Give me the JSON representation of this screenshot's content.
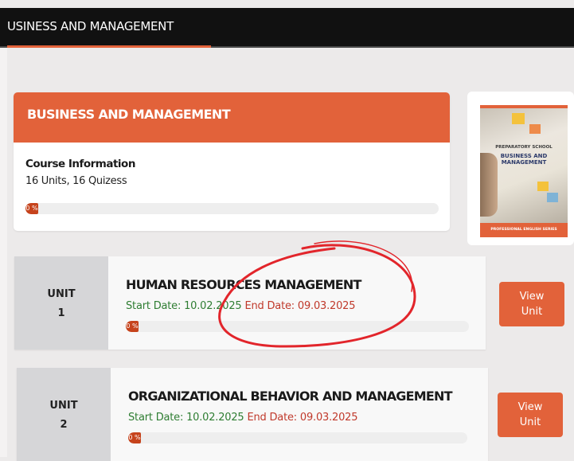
{
  "header": {
    "tab_label": "USINESS AND MANAGEMENT"
  },
  "course": {
    "title": "BUSINESS AND MANAGEMENT",
    "info_title": "Course Information",
    "info_sub": "16 Units, 16 Quizess",
    "progress_label": "0 %",
    "progress_value": 0
  },
  "cover": {
    "line1": "PREPARATORY SCHOOL",
    "line2": "BUSINESS AND",
    "line3": "MANAGEMENT",
    "series": "PROFESSIONAL ENGLISH SERIES"
  },
  "units": [
    {
      "unit_word": "UNIT",
      "unit_number": "1",
      "title": "HUMAN RESOURCES MANAGEMENT",
      "start": "Start Date: 10.02.2025",
      "end": "End Date: 09.03.2025",
      "progress_label": "0 %",
      "progress_value": 0,
      "button_line1": "View",
      "button_line2": "Unit"
    },
    {
      "unit_word": "UNIT",
      "unit_number": "2",
      "title": "ORGANIZATIONAL BEHAVIOR AND MANAGEMENT",
      "start": "Start Date: 10.02.2025",
      "end": "End Date: 09.03.2025",
      "progress_label": "0 %",
      "progress_value": 0,
      "button_line1": "View",
      "button_line2": "Unit"
    }
  ],
  "colors": {
    "accent": "#e2623a",
    "annotation": "#e2252b",
    "start_date": "#2e7d32",
    "end_date": "#c0392b"
  }
}
